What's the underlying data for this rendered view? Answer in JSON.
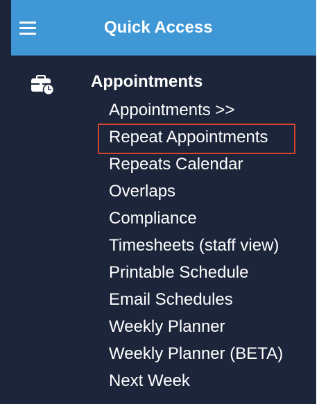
{
  "header": {
    "title": "Quick Access",
    "menu_icon": "hamburger-menu-icon"
  },
  "section": {
    "title": "Appointments",
    "icon": "briefcase-clock-icon",
    "items": [
      {
        "label": "Appointments >>"
      },
      {
        "label": "Repeat Appointments",
        "highlighted": true
      },
      {
        "label": "Repeats Calendar"
      },
      {
        "label": "Overlaps"
      },
      {
        "label": "Compliance"
      },
      {
        "label": "Timesheets (staff view)"
      },
      {
        "label": "Printable Schedule"
      },
      {
        "label": "Email Schedules"
      },
      {
        "label": "Weekly Planner"
      },
      {
        "label": "Weekly Planner (BETA)"
      },
      {
        "label": "Next Week"
      }
    ]
  },
  "colors": {
    "header_bg": "#3f97d6",
    "panel_bg": "#1c253a",
    "text": "#ffffff",
    "highlight_border": "#d3452f"
  }
}
